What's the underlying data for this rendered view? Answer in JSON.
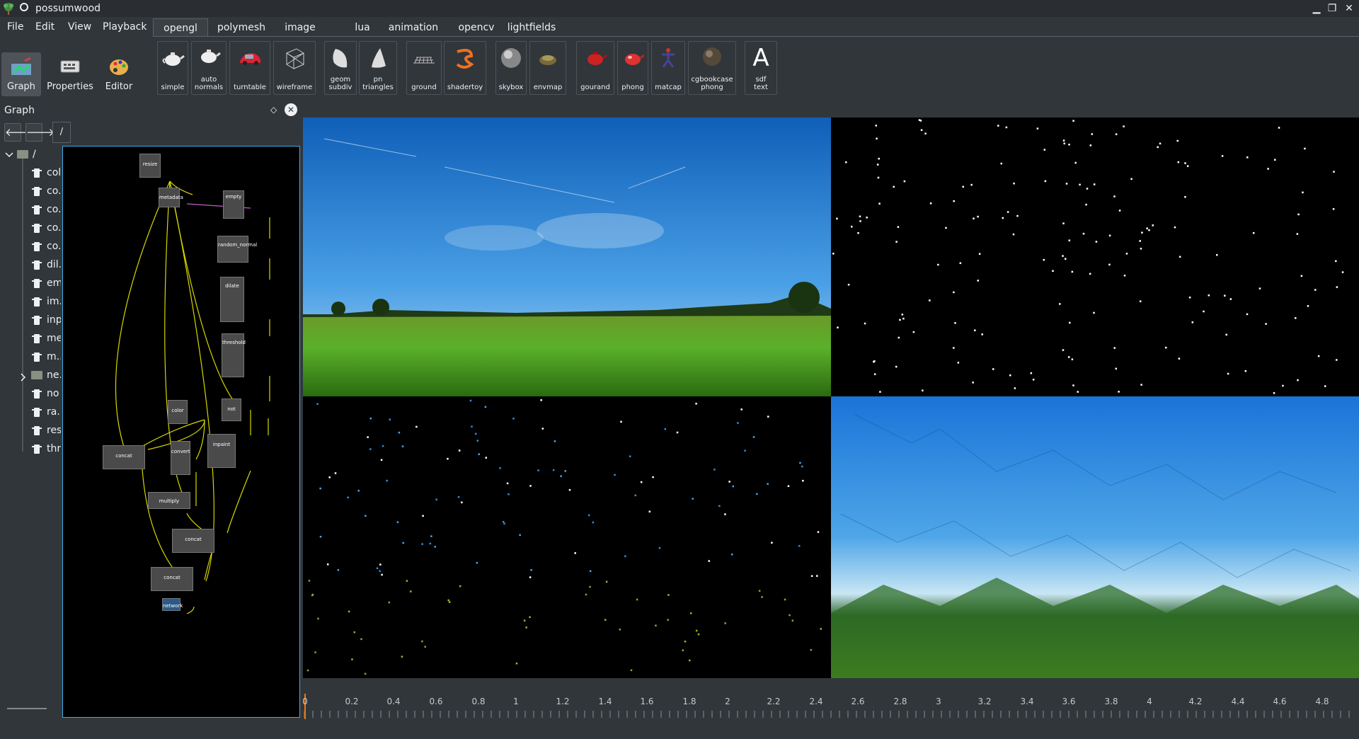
{
  "window": {
    "title": "possumwood",
    "controls": [
      "▁",
      "❐",
      "✕"
    ]
  },
  "menu": [
    "File",
    "Edit",
    "View",
    "Playback"
  ],
  "tabs": [
    {
      "label": "opengl",
      "active": true
    },
    {
      "label": "polymesh",
      "active": false
    },
    {
      "label": "image",
      "active": false
    },
    {
      "label": "lua",
      "active": false
    },
    {
      "label": "animation",
      "active": false
    },
    {
      "label": "opencv",
      "active": false
    },
    {
      "label": "lightfields",
      "active": false
    }
  ],
  "toolbar": [
    {
      "label": "simple",
      "icon": "teapot-icon"
    },
    {
      "label": "auto\nnormals",
      "icon": "teapot-icon"
    },
    {
      "label": "turntable",
      "icon": "car-icon"
    },
    {
      "label": "wireframe",
      "icon": "wireframe-cube-icon"
    },
    {
      "label": "geom\nsubdiv",
      "icon": "subdiv-shape-icon"
    },
    {
      "label": "pn\ntriangles",
      "icon": "cone-icon"
    },
    {
      "label": "ground",
      "icon": "ground-grid-icon"
    },
    {
      "label": "shadertoy",
      "icon": "shadertoy-swirl-icon"
    },
    {
      "label": "skybox",
      "icon": "sphere-icon"
    },
    {
      "label": "envmap",
      "icon": "envmap-icon"
    },
    {
      "label": "gourand",
      "icon": "teapot-red-icon"
    },
    {
      "label": "phong",
      "icon": "teapot-red-icon"
    },
    {
      "label": "matcap",
      "icon": "figure-icon"
    },
    {
      "label": "cgbookcase\nphong",
      "icon": "sphere-texture-icon"
    },
    {
      "label": "sdf\ntext",
      "icon": "sdf-text-icon",
      "glyph": "A"
    }
  ],
  "side_modes": [
    {
      "label": "Graph",
      "icon": "graph-icon",
      "active": true
    },
    {
      "label": "Properties",
      "icon": "properties-icon",
      "active": false
    },
    {
      "label": "Editor",
      "icon": "palette-icon",
      "active": false
    }
  ],
  "graph_dock": {
    "title": "Graph",
    "float_glyph": "◇",
    "close_glyph": "✕",
    "back_glyph": "🡐",
    "forward_glyph": "🡒",
    "path": "/",
    "tree_root": "/",
    "tree_items": [
      {
        "label": "col",
        "type": "file"
      },
      {
        "label": "co.",
        "type": "file"
      },
      {
        "label": "co.",
        "type": "file"
      },
      {
        "label": "co.",
        "type": "file"
      },
      {
        "label": "co.",
        "type": "file"
      },
      {
        "label": "dil.",
        "type": "file"
      },
      {
        "label": "em",
        "type": "file"
      },
      {
        "label": "im.",
        "type": "file"
      },
      {
        "label": "inp",
        "type": "file"
      },
      {
        "label": "me",
        "type": "file"
      },
      {
        "label": "m..",
        "type": "file"
      },
      {
        "label": "ne.",
        "type": "folder"
      },
      {
        "label": "no",
        "type": "file"
      },
      {
        "label": "ra.",
        "type": "file"
      },
      {
        "label": "res",
        "type": "file"
      },
      {
        "label": "thr",
        "type": "file"
      }
    ],
    "nodes": [
      "resize",
      "metadata",
      "empty",
      "random_normal",
      "dilate",
      "threshold",
      "color",
      "not",
      "concat",
      "convert",
      "inpaint",
      "multiply",
      "concat",
      "concat",
      "network"
    ]
  },
  "timeline": {
    "ticks": [
      "0",
      "0.2",
      "0.4",
      "0.6",
      "0.8",
      "1",
      "1.2",
      "1.4",
      "1.6",
      "1.8",
      "2",
      "2.2",
      "2.4",
      "2.6",
      "2.8",
      "3",
      "3.2",
      "3.4",
      "3.6",
      "3.8",
      "4",
      "4.2",
      "4.4",
      "4.6",
      "4.8"
    ],
    "cursor_color": "#f67400"
  },
  "colors": {
    "accent": "#3daee9",
    "background": "#31363b",
    "connection": "#d8d800"
  }
}
